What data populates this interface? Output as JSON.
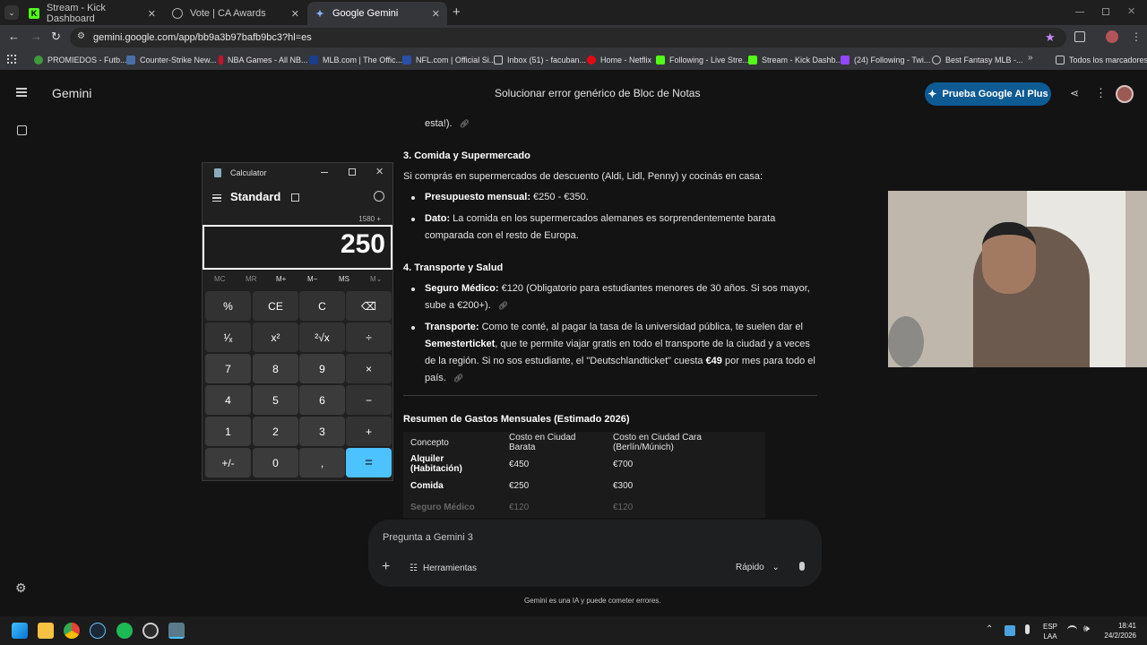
{
  "browser": {
    "tabs": [
      {
        "title": "Stream - Kick Dashboard",
        "active": false
      },
      {
        "title": "Vote | CA Awards",
        "active": false
      },
      {
        "title": "Google Gemini",
        "active": true
      }
    ],
    "url": "gemini.google.com/app/bb9a3b97bafb9bc3?hl=es",
    "bookmarks": [
      "PROMIEDOS - Futb...",
      "Counter-Strike New...",
      "NBA Games - All NB...",
      "MLB.com | The Offic...",
      "NFL.com | Official Si...",
      "Inbox (51) - facuban...",
      "Home - Netflix",
      "Following - Live Stre...",
      "Stream - Kick Dashb...",
      "(24) Following - Twi...",
      "Best Fantasy MLB -...",
      "Todos los marcadores"
    ]
  },
  "gemini": {
    "brand": "Gemini",
    "conversation_title": "Solucionar error genérico de Bloc de Notas",
    "pro_button": "Prueba Google AI Plus",
    "content": {
      "prev_tail": "esta!).",
      "sec3_title": "3. Comida y Supermercado",
      "sec3_intro": "Si comprás en supermercados de descuento (Aldi, Lidl, Penny) y cocinás en casa:",
      "sec3_b1_label": "Presupuesto mensual:",
      "sec3_b1_text": " €250 - €350.",
      "sec3_b2_label": "Dato:",
      "sec3_b2_text1": " La comida en los supermercados alemanes es sorprendentemente barata",
      "sec3_b2_text2": "comparada con el resto de Europa.",
      "sec4_title": "4. Transporte y Salud",
      "sec4_b1_label": "Seguro Médico:",
      "sec4_b1_text1": " €120 (Obligatorio para estudiantes menores de 30 años. Si sos mayor,",
      "sec4_b1_text2": "sube a €200+).",
      "sec4_b2_label": "Transporte:",
      "sec4_b2_text1": " Como te conté, al pagar la tasa de la universidad pública, te suelen dar el",
      "sec4_b2_bold2": "Semesterticket",
      "sec4_b2_text2": ", que te permite viajar gratis en todo el transporte de la ciudad y a veces",
      "sec4_b2_text3a": "de la región. Si no sos estudiante, el \"Deutschlandticket\" cuesta ",
      "sec4_b2_bold3": "€49",
      "sec4_b2_text3b": " por mes para todo el",
      "sec4_b2_text4": "país.",
      "summary_title": "Resumen de Gastos Mensuales (Estimado 2026)"
    },
    "table": {
      "headers": [
        "Concepto",
        "Costo en Ciudad Barata",
        "Costo en Ciudad Cara (Berlín/Múnich)"
      ],
      "rows": [
        [
          "Alquiler (Habitación)",
          "€450",
          "€700"
        ],
        [
          "Comida",
          "€250",
          "€300"
        ],
        [
          "Seguro Médico",
          "€120",
          "€120"
        ]
      ]
    },
    "input": {
      "placeholder": "Pregunta a Gemini 3",
      "tools_label": "Herramientas",
      "mode_label": "Rápido"
    },
    "disclaimer": "Gemini es una IA y puede cometer errores."
  },
  "calculator": {
    "window_title": "Calculator",
    "mode": "Standard",
    "expression": "1580 +",
    "display": "250",
    "memory": [
      "MC",
      "MR",
      "M+",
      "M−",
      "MS",
      "M⌄"
    ],
    "keys": [
      [
        "%",
        "CE",
        "C",
        "⌫"
      ],
      [
        "¹⁄ₓ",
        "x²",
        "²√x",
        "÷"
      ],
      [
        "7",
        "8",
        "9",
        "×"
      ],
      [
        "4",
        "5",
        "6",
        "−"
      ],
      [
        "1",
        "2",
        "3",
        "+"
      ],
      [
        "+/-",
        "0",
        ",",
        "="
      ]
    ]
  },
  "taskbar": {
    "lang1": "ESP",
    "lang2": "LAA",
    "time": "18:41",
    "date": "24/2/2026"
  }
}
